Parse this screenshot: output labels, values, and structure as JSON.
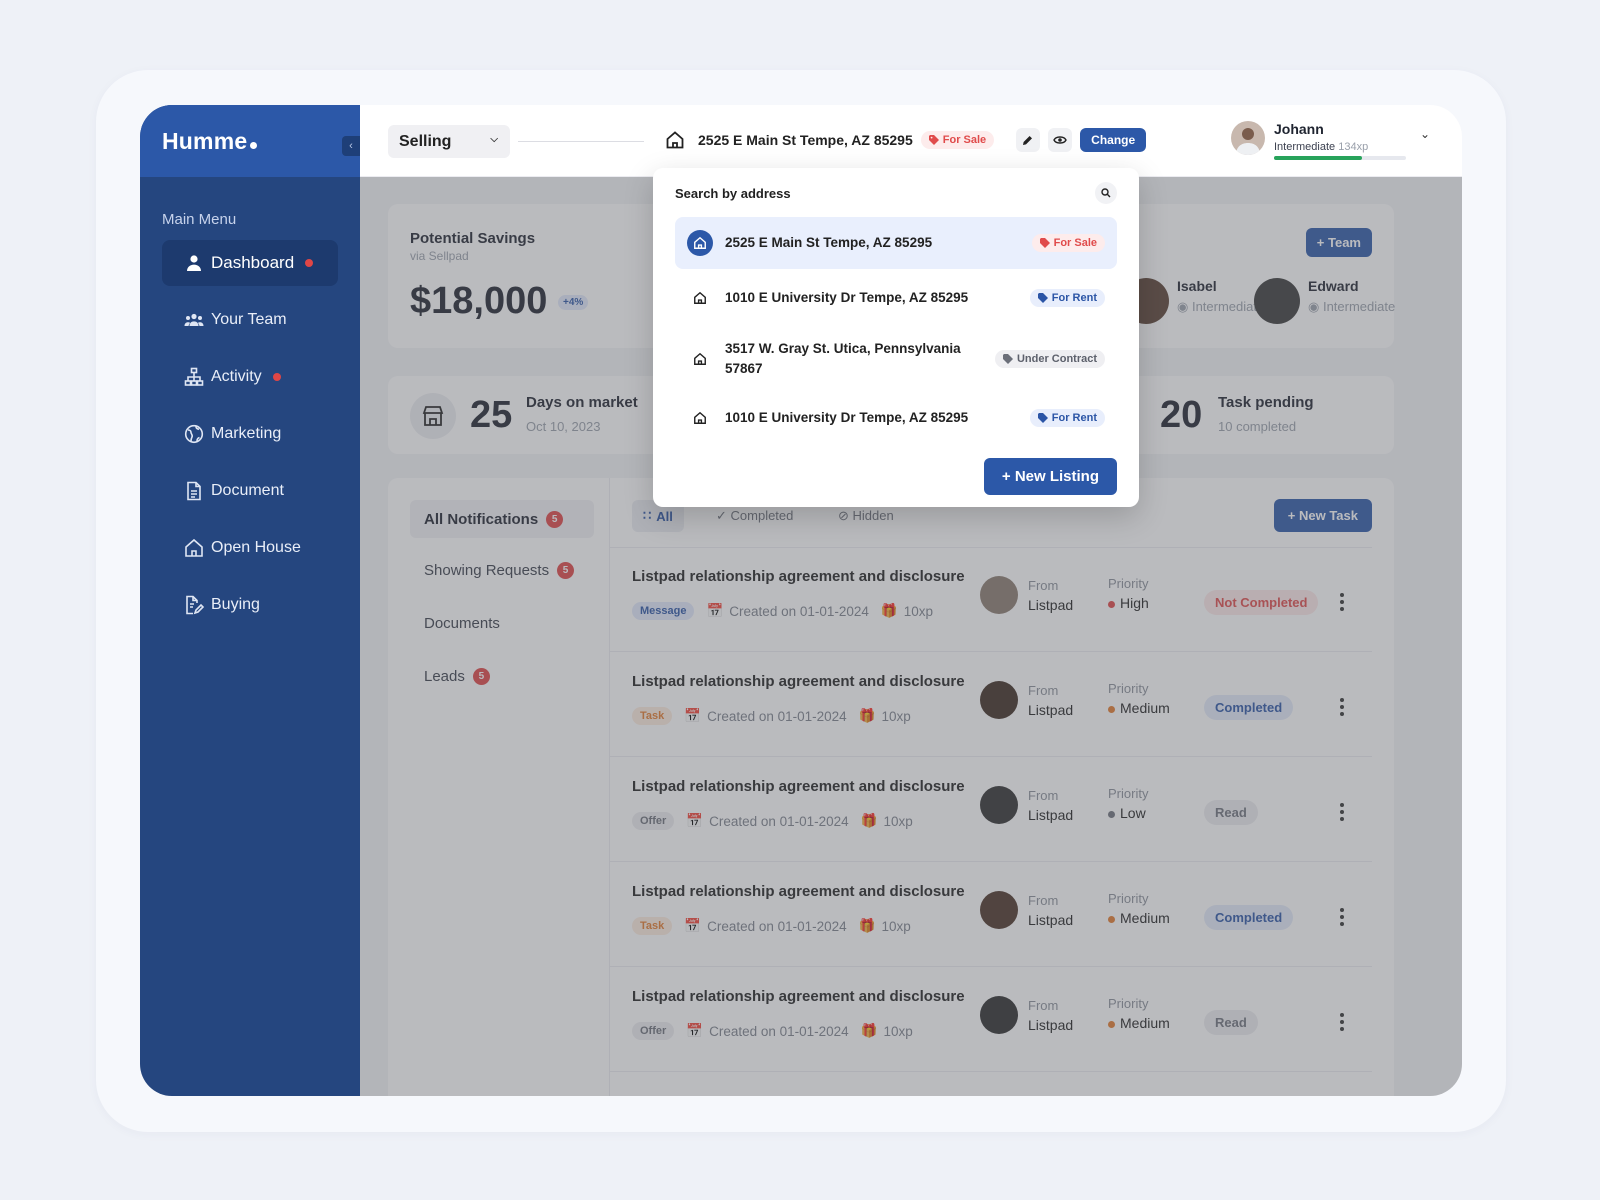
{
  "app": {
    "logo": "Humme"
  },
  "sidebar": {
    "menu_title": "Main Menu",
    "items": [
      {
        "label": "Dashboard",
        "icon": "user-icon",
        "active": true,
        "dot": true
      },
      {
        "label": "Your Team",
        "icon": "team-icon",
        "active": false,
        "dot": false
      },
      {
        "label": "Activity",
        "icon": "hierarchy-icon",
        "active": false,
        "dot": true
      },
      {
        "label": "Marketing",
        "icon": "globe-icon",
        "active": false,
        "dot": false
      },
      {
        "label": "Document",
        "icon": "document-icon",
        "active": false,
        "dot": false
      },
      {
        "label": "Open House",
        "icon": "house-icon",
        "active": false,
        "dot": false
      },
      {
        "label": "Buying",
        "icon": "edit-document-icon",
        "active": false,
        "dot": false
      }
    ]
  },
  "topbar": {
    "mode_select": "Selling",
    "address": "2525 E Main St Tempe, AZ 85295",
    "address_tag": "For Sale",
    "change_label": "Change",
    "user": {
      "name": "Johann",
      "level": "Intermediate",
      "xp": "134xp",
      "xp_progress": 0.67
    }
  },
  "savings": {
    "title": "Potential Savings",
    "subtitle": "via Sellpad",
    "amount": "$18,000",
    "delta": "+4%"
  },
  "team": {
    "button": "Team",
    "members": [
      {
        "name": "Isabel",
        "level": "Intermediate"
      },
      {
        "name": "Edward",
        "level": "Intermediate"
      }
    ]
  },
  "stats": {
    "days": {
      "value": "25",
      "label": "Days on market",
      "sub": "Oct 10, 2023"
    },
    "tasks": {
      "value": "20",
      "label": "Task pending",
      "sub": "10 completed"
    }
  },
  "notifications": {
    "categories": [
      {
        "label": "All Notifications",
        "count": "5"
      },
      {
        "label": "Showing Requests",
        "count": "5"
      },
      {
        "label": "Documents",
        "count": ""
      },
      {
        "label": "Leads",
        "count": "5"
      }
    ],
    "filters": [
      "All",
      "Completed",
      "Hidden"
    ],
    "new_task": "New Task",
    "items": [
      {
        "title": "Listpad relationship agreement and disclosure",
        "type": "Message",
        "created": "Created on 01-01-2024",
        "xp": "10xp",
        "from_label": "From",
        "from": "Listpad",
        "priority_label": "Priority",
        "priority": "High",
        "priority_color": "#e04646",
        "status": "Not Completed"
      },
      {
        "title": "Listpad relationship agreement and disclosure",
        "type": "Task",
        "created": "Created on 01-01-2024",
        "xp": "10xp",
        "from_label": "From",
        "from": "Listpad",
        "priority_label": "Priority",
        "priority": "Medium",
        "priority_color": "#e47b2d",
        "status": "Completed"
      },
      {
        "title": "Listpad relationship agreement and disclosure",
        "type": "Offer",
        "created": "Created on 01-01-2024",
        "xp": "10xp",
        "from_label": "From",
        "from": "Listpad",
        "priority_label": "Priority",
        "priority": "Low",
        "priority_color": "#6f737c",
        "status": "Read"
      },
      {
        "title": "Listpad relationship agreement and disclosure",
        "type": "Task",
        "created": "Created on 01-01-2024",
        "xp": "10xp",
        "from_label": "From",
        "from": "Listpad",
        "priority_label": "Priority",
        "priority": "Medium",
        "priority_color": "#e47b2d",
        "status": "Completed"
      },
      {
        "title": "Listpad relationship agreement and disclosure",
        "type": "Offer",
        "created": "Created on 01-01-2024",
        "xp": "10xp",
        "from_label": "From",
        "from": "Listpad",
        "priority_label": "Priority",
        "priority": "Medium",
        "priority_color": "#e47b2d",
        "status": "Read"
      }
    ]
  },
  "dropdown": {
    "title": "Search by address",
    "items": [
      {
        "address": "2525 E Main St Tempe, AZ 85295",
        "tag": "For Sale"
      },
      {
        "address": "1010 E University Dr Tempe, AZ 85295",
        "tag": "For Rent"
      },
      {
        "address": "3517 W. Gray St. Utica, Pennsylvania 57867",
        "tag": "Under Contract"
      },
      {
        "address": "1010 E University Dr Tempe, AZ 85295",
        "tag": "For Rent"
      }
    ],
    "new_listing": "New Listing"
  },
  "colors": {
    "brand": "#2c58a8",
    "sidebar": "#25467f",
    "danger": "#e04646",
    "success": "#27a35b"
  }
}
